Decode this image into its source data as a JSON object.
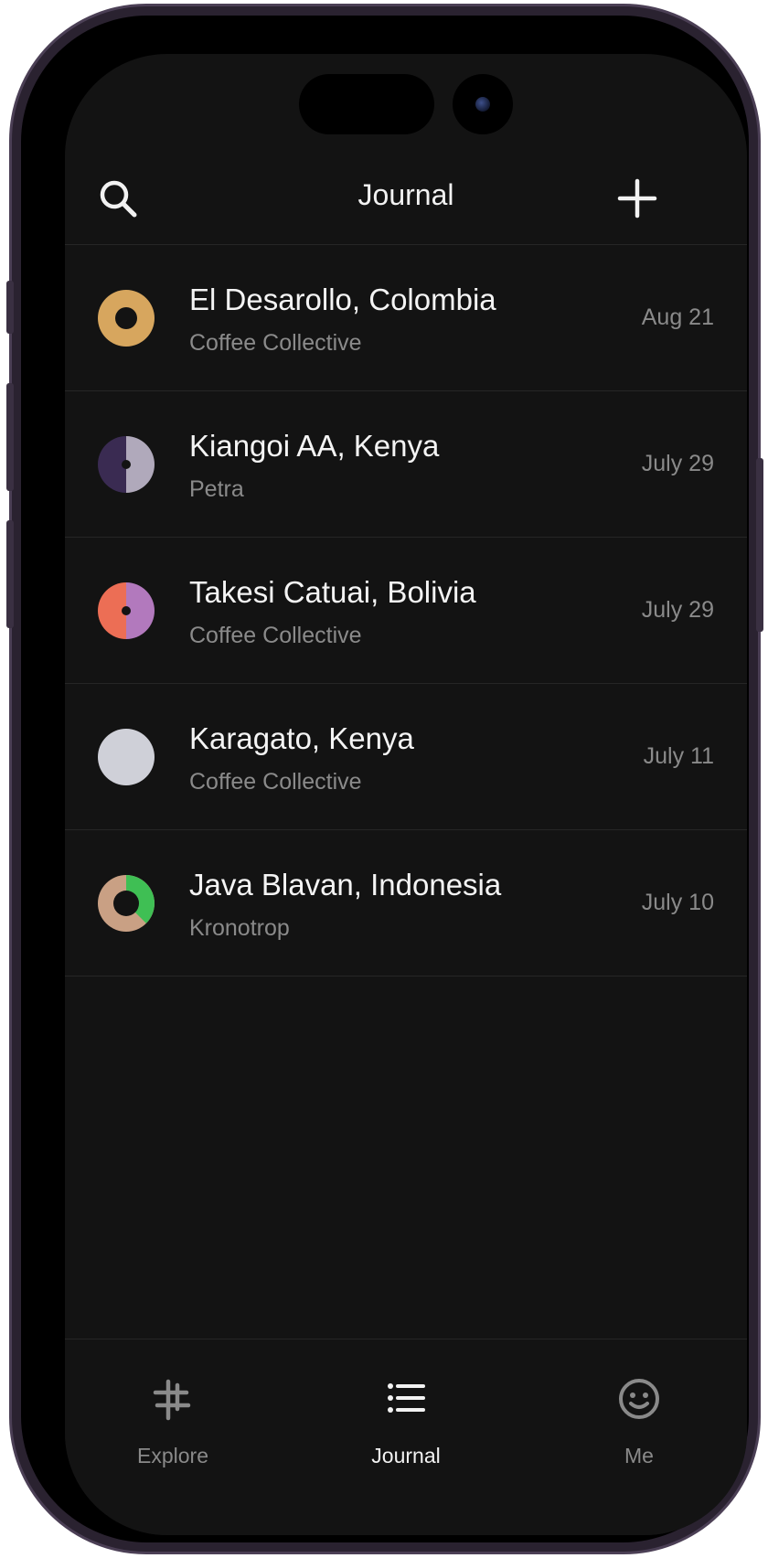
{
  "header": {
    "title": "Journal",
    "search_icon": "search-icon",
    "add_icon": "plus-icon"
  },
  "entries": [
    {
      "title": "El Desarollo, Colombia",
      "roaster": "Coffee Collective",
      "date": "Aug 21",
      "icon": "ring-gold",
      "colors": [
        "#d7a65e"
      ]
    },
    {
      "title": "Kiangoi AA, Kenya",
      "roaster": "Petra",
      "date": "July 29",
      "icon": "half-split",
      "colors": [
        "#3a2b52",
        "#b0a9bb"
      ]
    },
    {
      "title": "Takesi Catuai, Bolivia",
      "roaster": "Coffee Collective",
      "date": "July 29",
      "icon": "half-split",
      "colors": [
        "#ec6e55",
        "#b279bd"
      ]
    },
    {
      "title": "Karagato, Kenya",
      "roaster": "Coffee Collective",
      "date": "July 11",
      "icon": "solid-circle",
      "colors": [
        "#cfd0d8"
      ]
    },
    {
      "title": "Java Blavan, Indonesia",
      "roaster": "Kronotrop",
      "date": "July 10",
      "icon": "ring-split",
      "colors": [
        "#c9a084",
        "#3fbf54"
      ]
    }
  ],
  "tabs": [
    {
      "label": "Explore",
      "icon": "explore-icon",
      "active": false
    },
    {
      "label": "Journal",
      "icon": "list-icon",
      "active": true
    },
    {
      "label": "Me",
      "icon": "smiley-icon",
      "active": false
    }
  ],
  "colors": {
    "background": "#131313",
    "text_primary": "#f4f4f4",
    "text_secondary": "#8a8a8a",
    "divider": "#262626"
  }
}
